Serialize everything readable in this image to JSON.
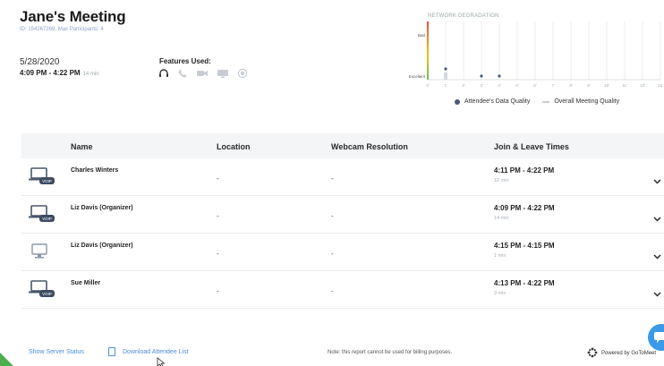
{
  "meeting": {
    "title": "Jane's Meeting",
    "id_line": "ID: 154267269, Max Participants: 4",
    "date": "5/28/2020",
    "time_range": "4:09 PM - 4:22 PM",
    "duration": "14 min",
    "features_label": "Features Used:",
    "features": [
      "headset-icon",
      "phone-icon",
      "webcam-icon",
      "screen-share-icon",
      "record-icon"
    ]
  },
  "network": {
    "title": "NETWORK DEGRADATION",
    "y_labels": [
      "Bad",
      "Excellent"
    ],
    "x_labels": [
      "0'",
      "1'",
      "2'",
      "3'",
      "4'",
      "5'",
      "6'",
      "7'",
      "8'",
      "9'",
      "10'",
      "11'",
      "12'",
      "13'"
    ],
    "legend": {
      "attendee": "Attendee's Data Quality",
      "overall": "Overall Meeting Quality"
    }
  },
  "chart_data": {
    "type": "scatter",
    "title": "NETWORK DEGRADATION",
    "x": [
      "0'",
      "1'",
      "2'",
      "3'",
      "4'",
      "5'",
      "6'",
      "7'",
      "8'",
      "9'",
      "10'",
      "11'",
      "12'",
      "13'"
    ],
    "series": [
      {
        "name": "Attendee's Data Quality",
        "points": [
          {
            "x": "1'",
            "y": "Excellent"
          },
          {
            "x": "3'",
            "y": "Excellent"
          },
          {
            "x": "4'",
            "y": "Excellent"
          }
        ]
      }
    ],
    "y_categories": [
      "Excellent",
      "Bad"
    ]
  },
  "table": {
    "headers": {
      "name": "Name",
      "location": "Location",
      "webcam": "Webcam Resolution",
      "times": "Join & Leave Times"
    },
    "rows": [
      {
        "device": "voip",
        "badge": "VOIP",
        "name": "Charles Winters",
        "location": "-",
        "webcam": "-",
        "times": "4:11 PM - 4:22 PM",
        "duration": "12 min"
      },
      {
        "device": "voip",
        "badge": "VOIP",
        "name": "Liz Davis (Organizer)",
        "location": "-",
        "webcam": "-",
        "times": "4:09 PM - 4:22 PM",
        "duration": "14 min"
      },
      {
        "device": "computer",
        "badge": "",
        "name": "Liz Davis (Organizer)",
        "location": "-",
        "webcam": "-",
        "times": "4:15 PM - 4:15 PM",
        "duration": "1 min"
      },
      {
        "device": "voip",
        "badge": "VOIP",
        "name": "Sue Miller",
        "location": "-",
        "webcam": "-",
        "times": "4:13 PM - 4:22 PM",
        "duration": "9 min"
      }
    ]
  },
  "footer": {
    "server_status": "Show Server Status",
    "download": "Download Attendee List",
    "note": "Note: this report cannot be used for billing purposes.",
    "powered": "Powered by GoToMeet"
  },
  "colors": {
    "link": "#4a90d9",
    "accent_fab": "#3b9ae8",
    "corner": "#4caf50"
  }
}
